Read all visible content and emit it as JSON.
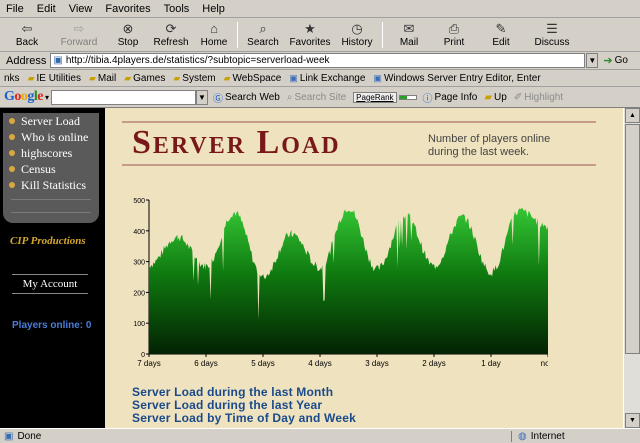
{
  "menu": [
    "File",
    "Edit",
    "View",
    "Favorites",
    "Tools",
    "Help"
  ],
  "toolbar": {
    "back": "Back",
    "forward": "Forward",
    "stop": "Stop",
    "refresh": "Refresh",
    "home": "Home",
    "search": "Search",
    "favorites": "Favorites",
    "history": "History",
    "mail": "Mail",
    "print": "Print",
    "edit": "Edit",
    "discuss": "Discuss"
  },
  "address": {
    "label": "Address",
    "url": "http://tibia.4players.de/statistics/?subtopic=serverload-week",
    "go": "Go"
  },
  "links": {
    "label": "nks",
    "items": [
      "IE Utilities",
      "Mail",
      "Games",
      "System",
      "WebSpace",
      "Link Exchange",
      "Windows Server Entry Editor, Enter"
    ]
  },
  "google": {
    "search_web": "Search Web",
    "search_site": "Search Site",
    "pagerank": "PageRank",
    "page_info": "Page Info",
    "up": "Up",
    "highlight": "Highlight"
  },
  "sidebar": {
    "nav": [
      "Server Load",
      "Who is online",
      "highscores",
      "Census",
      "Kill Statistics"
    ],
    "brand": "CIP Productions",
    "account": "My Account",
    "players_online": "Players online: 0"
  },
  "page": {
    "title": "Server Load",
    "subtitle": "Number of players online during the last week.",
    "links": [
      "Server Load during the last Month",
      "Server Load during the last Year",
      "Server Load by Time of Day and Week"
    ]
  },
  "chart_data": {
    "type": "area",
    "title": "",
    "xlabel": "",
    "ylabel": "",
    "ylim": [
      0,
      500
    ],
    "yticks": [
      "0",
      "100",
      "200",
      "300",
      "400",
      "500"
    ],
    "xticks": [
      "7 days",
      "6 days",
      "5 days",
      "4 days",
      "3 days",
      "2 days",
      "1 day",
      "now"
    ],
    "peaks": [
      {
        "x": "6.5 days",
        "y": 380
      },
      {
        "x": "5.5 days",
        "y": 460
      },
      {
        "x": "4.5 days",
        "y": 390
      },
      {
        "x": "3.5 days",
        "y": 475
      },
      {
        "x": "2.5 days",
        "y": 450
      },
      {
        "x": "1.5 days",
        "y": 445
      },
      {
        "x": "0.5 days",
        "y": 465
      },
      {
        "x": "now",
        "y": 415
      }
    ],
    "troughs": [
      {
        "x": "7 days",
        "y": 290
      },
      {
        "x": "6 days",
        "y": 285
      },
      {
        "x": "5 days",
        "y": 250
      },
      {
        "x": "4 days",
        "y": 280
      },
      {
        "x": "3 days",
        "y": 275
      },
      {
        "x": "2 days",
        "y": 285
      },
      {
        "x": "1 day",
        "y": 265
      }
    ],
    "colors": {
      "fill": "#0f7a0f",
      "top": "#35c635",
      "bottom": "#032203"
    }
  },
  "status": {
    "left": "Done",
    "right": "Internet"
  }
}
